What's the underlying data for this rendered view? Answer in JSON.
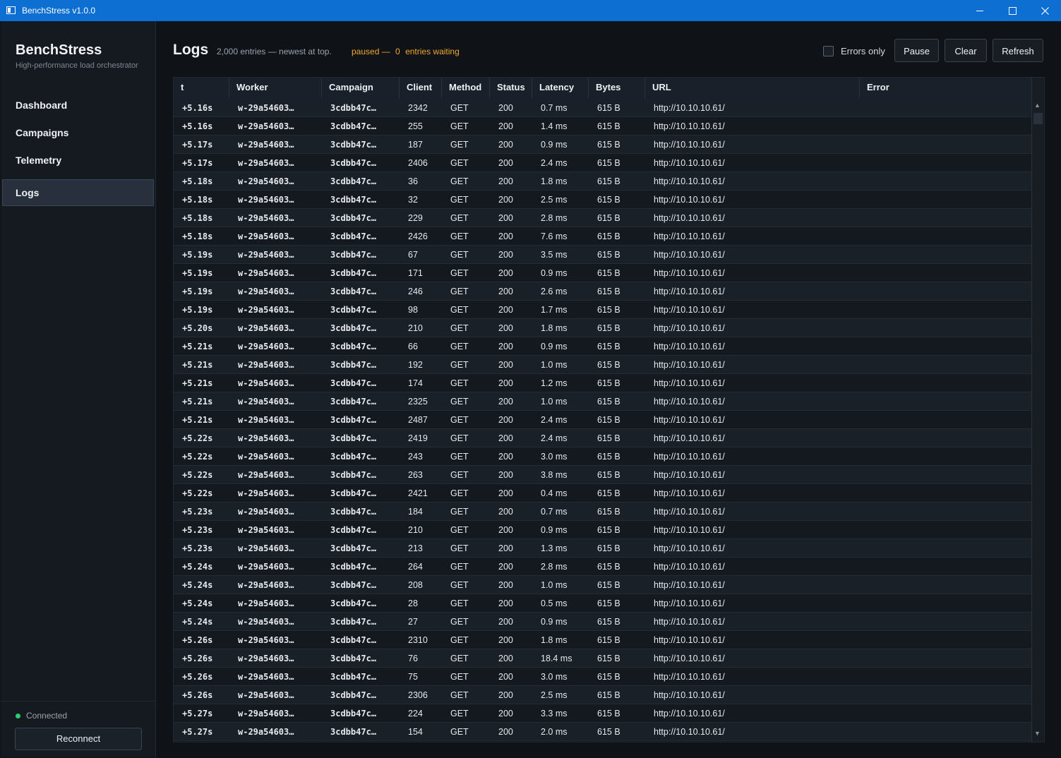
{
  "window": {
    "title": "BenchStress  v1.0.0"
  },
  "sidebar": {
    "brand": "BenchStress",
    "tagline": "High-performance load orchestrator",
    "nav": [
      {
        "label": "Dashboard"
      },
      {
        "label": "Campaigns"
      },
      {
        "label": "Telemetry"
      },
      {
        "label": "Logs"
      }
    ],
    "active_nav": "Logs",
    "status": "Connected",
    "status_color": "#2ecc71",
    "reconnect_label": "Reconnect"
  },
  "header": {
    "title": "Logs",
    "info": "2,000 entries — newest at top.",
    "paused_label": "paused —",
    "waiting_count": "0",
    "waiting_label": "entries waiting",
    "errors_only_label": "Errors only",
    "errors_only_checked": false,
    "pause_label": "Pause",
    "clear_label": "Clear",
    "refresh_label": "Refresh"
  },
  "table": {
    "columns": [
      "t",
      "Worker",
      "Campaign",
      "Client",
      "Method",
      "Status",
      "Latency",
      "Bytes",
      "URL",
      "Error"
    ],
    "rows": [
      [
        "+5.16s",
        "w-29a54603…",
        "3cdbb47c…",
        "2342",
        "GET",
        "200",
        "0.7 ms",
        "615 B",
        "http://10.10.10.61/",
        ""
      ],
      [
        "+5.16s",
        "w-29a54603…",
        "3cdbb47c…",
        "255",
        "GET",
        "200",
        "1.4 ms",
        "615 B",
        "http://10.10.10.61/",
        ""
      ],
      [
        "+5.17s",
        "w-29a54603…",
        "3cdbb47c…",
        "187",
        "GET",
        "200",
        "0.9 ms",
        "615 B",
        "http://10.10.10.61/",
        ""
      ],
      [
        "+5.17s",
        "w-29a54603…",
        "3cdbb47c…",
        "2406",
        "GET",
        "200",
        "2.4 ms",
        "615 B",
        "http://10.10.10.61/",
        ""
      ],
      [
        "+5.18s",
        "w-29a54603…",
        "3cdbb47c…",
        "36",
        "GET",
        "200",
        "1.8 ms",
        "615 B",
        "http://10.10.10.61/",
        ""
      ],
      [
        "+5.18s",
        "w-29a54603…",
        "3cdbb47c…",
        "32",
        "GET",
        "200",
        "2.5 ms",
        "615 B",
        "http://10.10.10.61/",
        ""
      ],
      [
        "+5.18s",
        "w-29a54603…",
        "3cdbb47c…",
        "229",
        "GET",
        "200",
        "2.8 ms",
        "615 B",
        "http://10.10.10.61/",
        ""
      ],
      [
        "+5.18s",
        "w-29a54603…",
        "3cdbb47c…",
        "2426",
        "GET",
        "200",
        "7.6 ms",
        "615 B",
        "http://10.10.10.61/",
        ""
      ],
      [
        "+5.19s",
        "w-29a54603…",
        "3cdbb47c…",
        "67",
        "GET",
        "200",
        "3.5 ms",
        "615 B",
        "http://10.10.10.61/",
        ""
      ],
      [
        "+5.19s",
        "w-29a54603…",
        "3cdbb47c…",
        "171",
        "GET",
        "200",
        "0.9 ms",
        "615 B",
        "http://10.10.10.61/",
        ""
      ],
      [
        "+5.19s",
        "w-29a54603…",
        "3cdbb47c…",
        "246",
        "GET",
        "200",
        "2.6 ms",
        "615 B",
        "http://10.10.10.61/",
        ""
      ],
      [
        "+5.19s",
        "w-29a54603…",
        "3cdbb47c…",
        "98",
        "GET",
        "200",
        "1.7 ms",
        "615 B",
        "http://10.10.10.61/",
        ""
      ],
      [
        "+5.20s",
        "w-29a54603…",
        "3cdbb47c…",
        "210",
        "GET",
        "200",
        "1.8 ms",
        "615 B",
        "http://10.10.10.61/",
        ""
      ],
      [
        "+5.21s",
        "w-29a54603…",
        "3cdbb47c…",
        "66",
        "GET",
        "200",
        "0.9 ms",
        "615 B",
        "http://10.10.10.61/",
        ""
      ],
      [
        "+5.21s",
        "w-29a54603…",
        "3cdbb47c…",
        "192",
        "GET",
        "200",
        "1.0 ms",
        "615 B",
        "http://10.10.10.61/",
        ""
      ],
      [
        "+5.21s",
        "w-29a54603…",
        "3cdbb47c…",
        "174",
        "GET",
        "200",
        "1.2 ms",
        "615 B",
        "http://10.10.10.61/",
        ""
      ],
      [
        "+5.21s",
        "w-29a54603…",
        "3cdbb47c…",
        "2325",
        "GET",
        "200",
        "1.0 ms",
        "615 B",
        "http://10.10.10.61/",
        ""
      ],
      [
        "+5.21s",
        "w-29a54603…",
        "3cdbb47c…",
        "2487",
        "GET",
        "200",
        "2.4 ms",
        "615 B",
        "http://10.10.10.61/",
        ""
      ],
      [
        "+5.22s",
        "w-29a54603…",
        "3cdbb47c…",
        "2419",
        "GET",
        "200",
        "2.4 ms",
        "615 B",
        "http://10.10.10.61/",
        ""
      ],
      [
        "+5.22s",
        "w-29a54603…",
        "3cdbb47c…",
        "243",
        "GET",
        "200",
        "3.0 ms",
        "615 B",
        "http://10.10.10.61/",
        ""
      ],
      [
        "+5.22s",
        "w-29a54603…",
        "3cdbb47c…",
        "263",
        "GET",
        "200",
        "3.8 ms",
        "615 B",
        "http://10.10.10.61/",
        ""
      ],
      [
        "+5.22s",
        "w-29a54603…",
        "3cdbb47c…",
        "2421",
        "GET",
        "200",
        "0.4 ms",
        "615 B",
        "http://10.10.10.61/",
        ""
      ],
      [
        "+5.23s",
        "w-29a54603…",
        "3cdbb47c…",
        "184",
        "GET",
        "200",
        "0.7 ms",
        "615 B",
        "http://10.10.10.61/",
        ""
      ],
      [
        "+5.23s",
        "w-29a54603…",
        "3cdbb47c…",
        "210",
        "GET",
        "200",
        "0.9 ms",
        "615 B",
        "http://10.10.10.61/",
        ""
      ],
      [
        "+5.23s",
        "w-29a54603…",
        "3cdbb47c…",
        "213",
        "GET",
        "200",
        "1.3 ms",
        "615 B",
        "http://10.10.10.61/",
        ""
      ],
      [
        "+5.24s",
        "w-29a54603…",
        "3cdbb47c…",
        "264",
        "GET",
        "200",
        "2.8 ms",
        "615 B",
        "http://10.10.10.61/",
        ""
      ],
      [
        "+5.24s",
        "w-29a54603…",
        "3cdbb47c…",
        "208",
        "GET",
        "200",
        "1.0 ms",
        "615 B",
        "http://10.10.10.61/",
        ""
      ],
      [
        "+5.24s",
        "w-29a54603…",
        "3cdbb47c…",
        "28",
        "GET",
        "200",
        "0.5 ms",
        "615 B",
        "http://10.10.10.61/",
        ""
      ],
      [
        "+5.24s",
        "w-29a54603…",
        "3cdbb47c…",
        "27",
        "GET",
        "200",
        "0.9 ms",
        "615 B",
        "http://10.10.10.61/",
        ""
      ],
      [
        "+5.26s",
        "w-29a54603…",
        "3cdbb47c…",
        "2310",
        "GET",
        "200",
        "1.8 ms",
        "615 B",
        "http://10.10.10.61/",
        ""
      ],
      [
        "+5.26s",
        "w-29a54603…",
        "3cdbb47c…",
        "76",
        "GET",
        "200",
        "18.4 ms",
        "615 B",
        "http://10.10.10.61/",
        ""
      ],
      [
        "+5.26s",
        "w-29a54603…",
        "3cdbb47c…",
        "75",
        "GET",
        "200",
        "3.0 ms",
        "615 B",
        "http://10.10.10.61/",
        ""
      ],
      [
        "+5.26s",
        "w-29a54603…",
        "3cdbb47c…",
        "2306",
        "GET",
        "200",
        "2.5 ms",
        "615 B",
        "http://10.10.10.61/",
        ""
      ],
      [
        "+5.27s",
        "w-29a54603…",
        "3cdbb47c…",
        "224",
        "GET",
        "200",
        "3.3 ms",
        "615 B",
        "http://10.10.10.61/",
        ""
      ],
      [
        "+5.27s",
        "w-29a54603…",
        "3cdbb47c…",
        "154",
        "GET",
        "200",
        "2.0 ms",
        "615 B",
        "http://10.10.10.61/",
        ""
      ]
    ]
  }
}
